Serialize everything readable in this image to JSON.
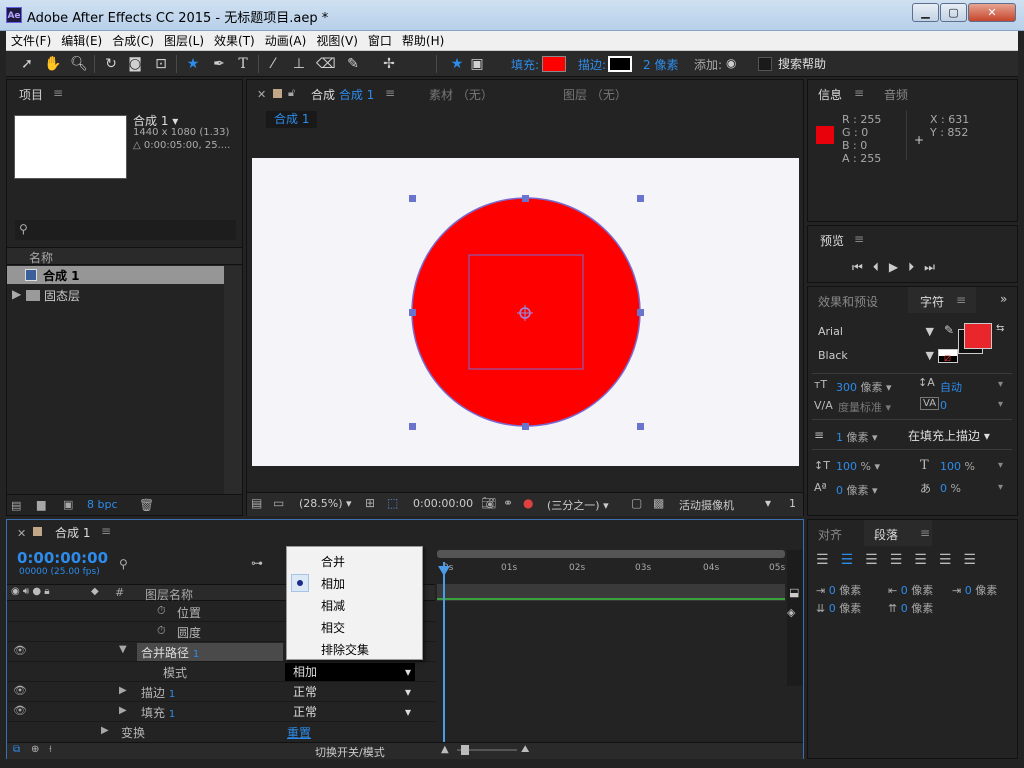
{
  "window": {
    "title": "Adobe After Effects CC 2015 - 无标题项目.aep *",
    "logo": "Ae",
    "min": "▁",
    "max": "▢",
    "close": "✕"
  },
  "menu": [
    "文件(F)",
    "编辑(E)",
    "合成(C)",
    "图层(L)",
    "效果(T)",
    "动画(A)",
    "视图(V)",
    "窗口",
    "帮助(H)"
  ],
  "toolbar": {
    "fill_label": "填充:",
    "stroke_label": "描边:",
    "stroke_width": "2 像素",
    "add_label": "添加:",
    "search_help": "搜索帮助",
    "fill_color": "#ff0000"
  },
  "project": {
    "panel_title": "项目",
    "comp_name": "合成 1 ▾",
    "comp_size": "1440 x 1080 (1.33)",
    "comp_duration": "△ 0:00:05:00, 25....",
    "column_name": "名称",
    "items": [
      "合成 1",
      "固态层"
    ],
    "bpc": "8 bpc"
  },
  "comp_panel": {
    "tab_label": "合成",
    "tab_comp": "合成 1",
    "footage_tab": "素材 （无）",
    "layer_tab": "图层 （无）",
    "breadcrumb": "合成 1",
    "zoom": "(28.5%)",
    "timecode": "0:00:00:00",
    "resolution": "(三分之一)",
    "camera": "活动摄像机",
    "views": "1"
  },
  "info": {
    "tab_info": "信息",
    "tab_audio": "音频",
    "r": "R : 255",
    "g": "G : 0",
    "b": "B : 0",
    "a": "A : 255",
    "x": "X : 631",
    "y": "Y : 852",
    "swatch": "#e8000a"
  },
  "preview": {
    "title": "预览"
  },
  "character": {
    "tab_effects": "效果和预设",
    "tab_char": "字符",
    "font": "Arial",
    "style": "Black",
    "size_val": "300",
    "size_unit": "像素",
    "leading": "自动",
    "kerning": "度量标准",
    "tracking": "0",
    "stroke_w": "1",
    "stroke_unit": "像素",
    "stroke_mode": "在填充上描边",
    "vscale": "100",
    "hscale": "100",
    "pct": "%",
    "baseline": "0",
    "baseline_unit": "像素",
    "tsume": "0",
    "tsume_pct": "%",
    "color": "#e8262b"
  },
  "paragraph": {
    "tab_align": "对齐",
    "tab_para": "段落",
    "v1": "0",
    "v2": "0",
    "v3": "0",
    "v4": "0",
    "v5": "0",
    "unit": "像素"
  },
  "timeline": {
    "tab": "合成 1",
    "timecode": "0:00:00:00",
    "frames": "00000 (25.00 fps)",
    "layer_name_col": "图层名称",
    "hash": "#",
    "ruler": [
      "0s",
      "01s",
      "02s",
      "03s",
      "04s",
      "05s"
    ],
    "rows": [
      "位置",
      "圆度",
      "合并路径",
      "模式",
      "描边",
      "填充",
      "变换"
    ],
    "row_nums": [
      "1",
      "1",
      "1"
    ],
    "mode_value": "相加",
    "stroke_blend": "正常",
    "fill_blend": "正常",
    "reset": "重置",
    "footer": "切换开关/模式"
  },
  "dropdown": {
    "items": [
      "合并",
      "相加",
      "相减",
      "相交",
      "排除交集"
    ],
    "selected_index": 1
  }
}
